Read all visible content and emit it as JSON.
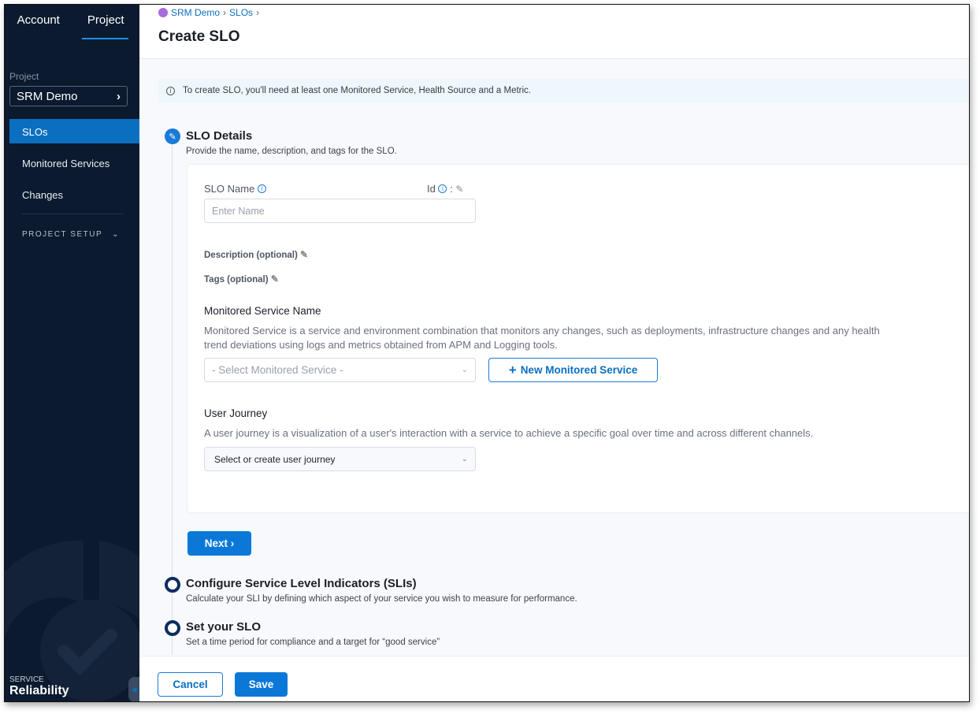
{
  "sidebar": {
    "tabs": [
      "Account",
      "Project"
    ],
    "project_label": "Project",
    "project_value": "SRM Demo",
    "items": [
      "SLOs",
      "Monitored Services",
      "Changes"
    ],
    "project_setup": "PROJECT SETUP",
    "module_small": "SERVICE",
    "module_name": "Reliability"
  },
  "header": {
    "breadcrumbs": [
      "SRM Demo",
      "SLOs"
    ],
    "title": "Create SLO"
  },
  "banner": "To create SLO, you'll need at least one Monitored Service, Health Source and a Metric.",
  "steps": [
    {
      "title": "SLO Details",
      "subtitle": "Provide the name, description, and tags for the SLO.",
      "state": "active"
    },
    {
      "title": "Configure Service Level Indicators (SLIs)",
      "subtitle": "Calculate your SLI by defining which aspect of your service you wish to measure for performance.",
      "state": "pending"
    },
    {
      "title": "Set your SLO",
      "subtitle": "Set a time period for compliance and a target for “good service”",
      "state": "pending"
    }
  ],
  "form": {
    "slo_name_label": "SLO Name",
    "id_label": "Id",
    "id_colon": ":",
    "name_placeholder": "Enter Name",
    "description_label": "Description (optional)",
    "tags_label": "Tags (optional)",
    "monitored_service_title": "Monitored Service Name",
    "monitored_service_desc": "Monitored Service is a service and environment combination that monitors any changes, such as deployments, infrastructure changes and any health trend deviations using logs and metrics obtained from APM and Logging tools.",
    "monitored_service_placeholder": "- Select Monitored Service -",
    "new_monitored_service": "New Monitored Service",
    "user_journey_title": "User Journey",
    "user_journey_desc": "A user journey is a visualization of a user's interaction with a service to achieve a specific goal over time and across different channels.",
    "user_journey_value": "Select or create user journey",
    "next": "Next"
  },
  "footer": {
    "cancel": "Cancel",
    "save": "Save"
  },
  "colors": {
    "sidebar": "#0b1a2e",
    "accent": "#0b78d8",
    "active_nav": "#0b6fc0"
  }
}
